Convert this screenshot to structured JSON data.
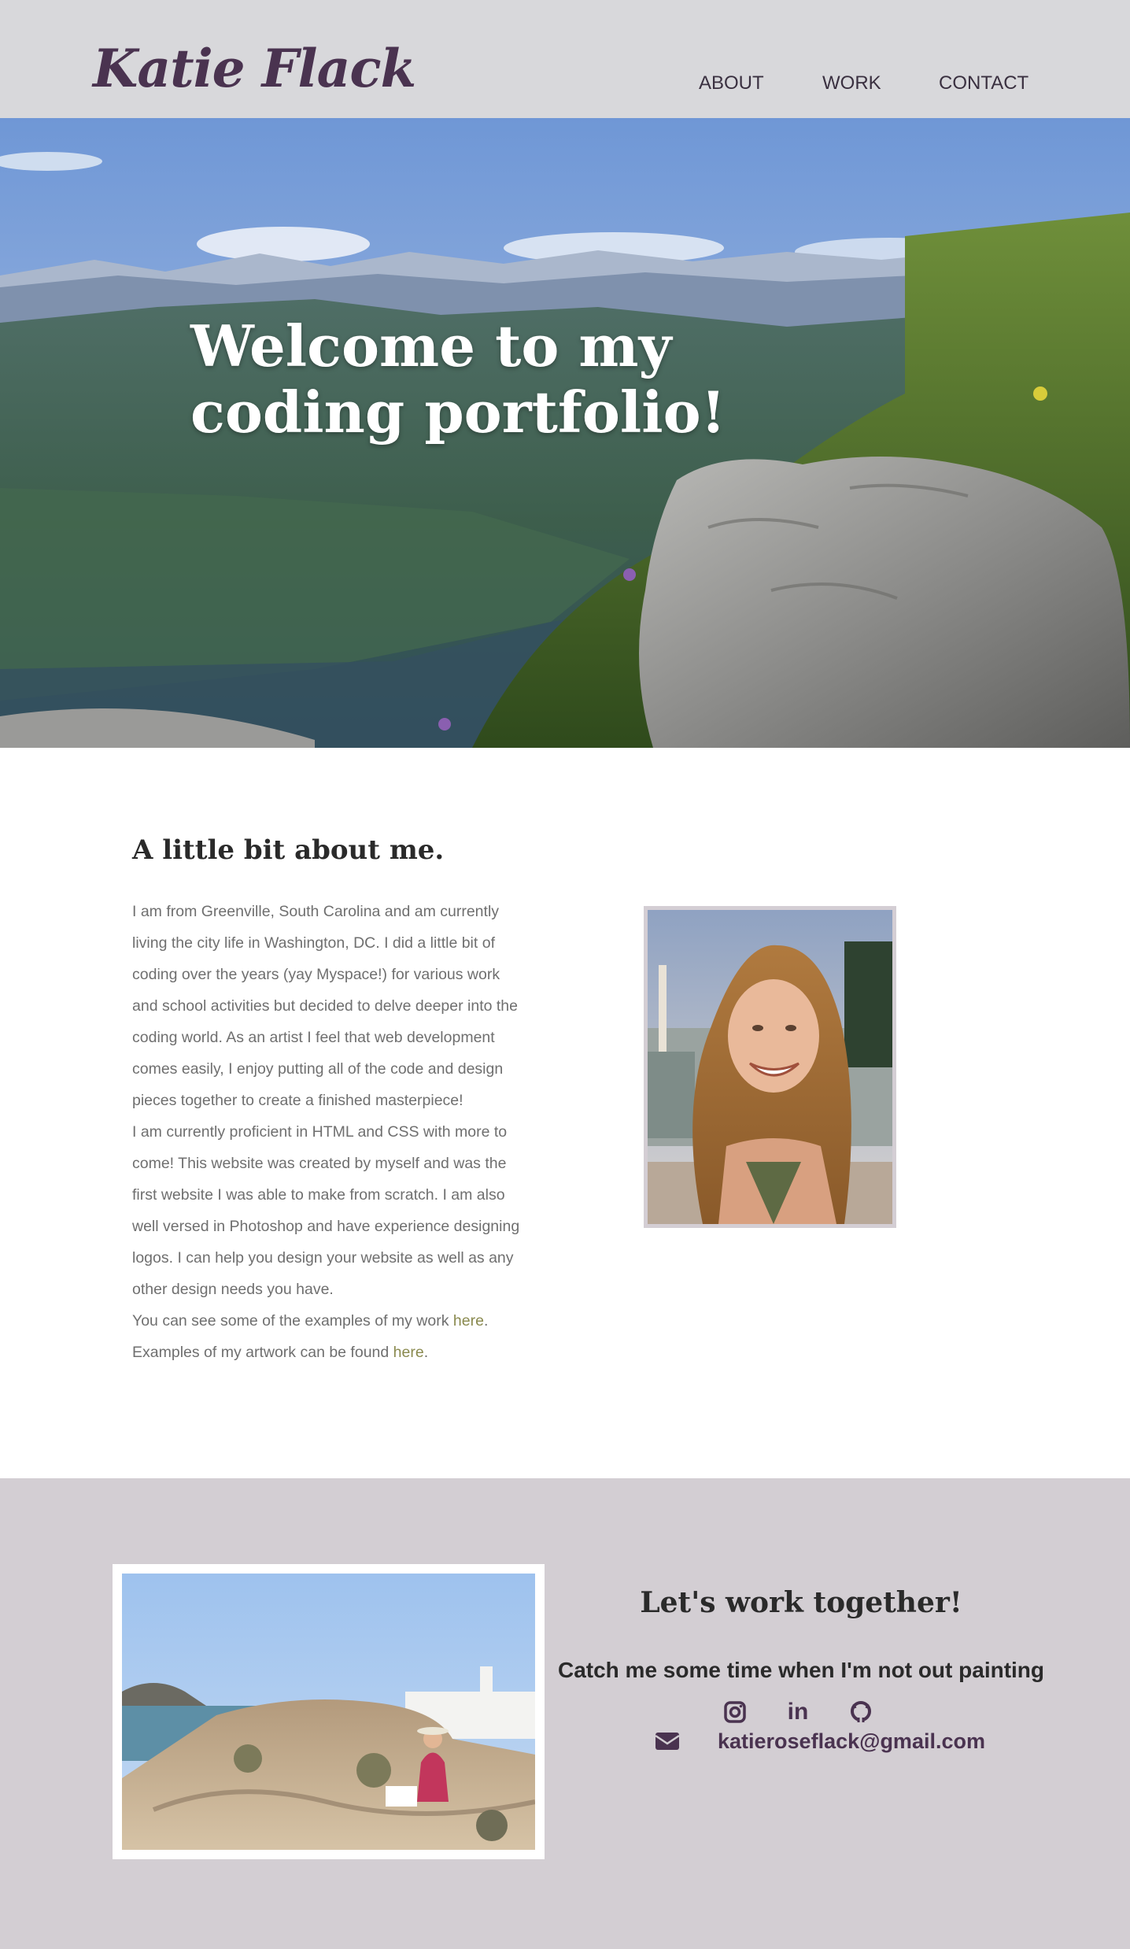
{
  "header": {
    "logo": "Katie Flack",
    "nav": [
      "ABOUT",
      "WORK",
      "CONTACT"
    ]
  },
  "hero": {
    "title": "Welcome to my coding portfolio!"
  },
  "about": {
    "heading": "A little bit about me.",
    "paragraph1": "I am from Greenville, South Carolina and am currently living the city life in Washington, DC. I did a little bit of coding over the years (yay Myspace!) for various work and school activities but decided to delve deeper into the coding world. As an artist I feel that web development comes easily, I enjoy putting all of the code and design pieces together to create a finished masterpiece!",
    "paragraph2": "I am currently proficient in HTML and CSS with more to come! This website was created by myself and was the first website I was able to make from scratch. I am also well versed in Photoshop and have experience designing logos. I can help you design your website as well as any other design needs you have.",
    "work_line": {
      "text": "You can see some of the examples of my work ",
      "link": "here",
      "end": "."
    },
    "art_line": {
      "text": "Examples of my artwork can be found ",
      "link": "here",
      "end": "."
    }
  },
  "footer": {
    "heading": "Let's work together!",
    "subheading": "Catch me some time when I'm not out painting",
    "social_icons": [
      "instagram-icon",
      "linkedin-icon",
      "github-icon"
    ],
    "linkedin_glyph": "in",
    "mail_icon": "envelope-icon",
    "email": "katieroseflack@gmail.com"
  },
  "colors": {
    "header_bg": "#d8d8db",
    "brand_purple": "#4a3350",
    "footer_bg": "#d3ced3",
    "link_olive": "#8a8a4f",
    "body_text": "#6f6f6f"
  }
}
